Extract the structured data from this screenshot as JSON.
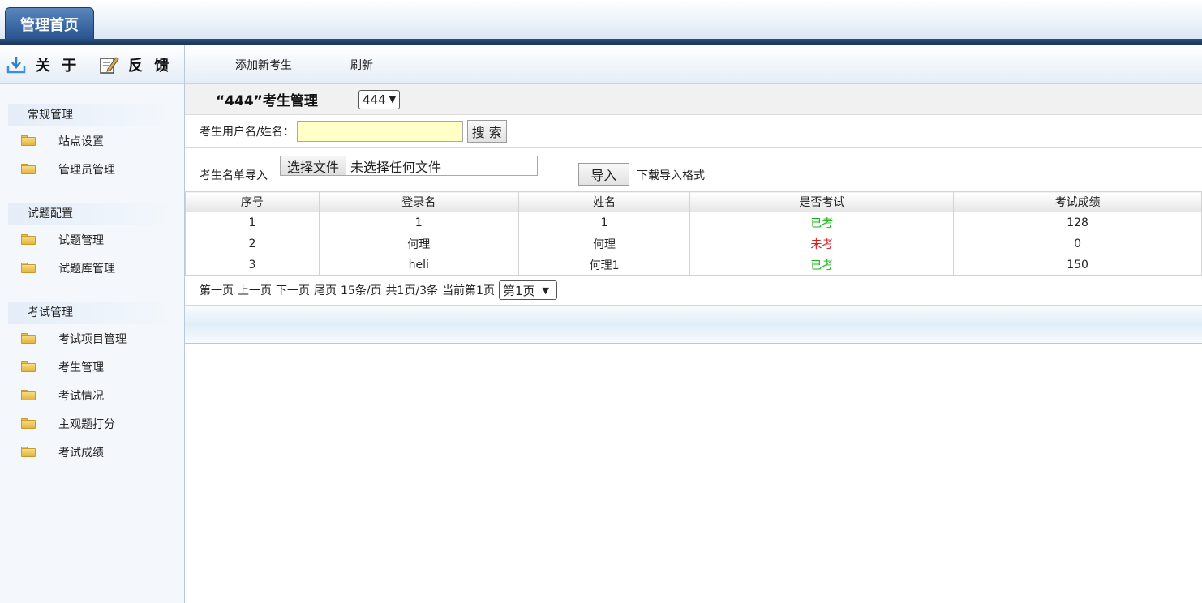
{
  "header": {
    "home_tab": "管理首页"
  },
  "sidebar": {
    "tools": {
      "about": "关 于",
      "feedback": "反 馈"
    },
    "sections": [
      {
        "title": "常规管理",
        "items": [
          "站点设置",
          "管理员管理"
        ]
      },
      {
        "title": "试题配置",
        "items": [
          "试题管理",
          "试题库管理"
        ]
      },
      {
        "title": "考试管理",
        "items": [
          "考试项目管理",
          "考生管理",
          "考试情况",
          "主观题打分",
          "考试成绩"
        ]
      }
    ]
  },
  "toolbar": {
    "add": "添加新考生",
    "refresh": "刷新"
  },
  "page": {
    "title": "“444”考生管理",
    "exam_select": "444"
  },
  "search": {
    "label": "考生用户名/姓名：",
    "value": "",
    "button": "搜 索"
  },
  "import": {
    "label": "考生名单导入",
    "file_button": "选择文件",
    "file_status": "未选择任何文件",
    "import_button": "导入",
    "download_link": "下载导入格式"
  },
  "table": {
    "columns": [
      "序号",
      "登录名",
      "姓名",
      "是否考试",
      "考试成绩"
    ],
    "rows": [
      {
        "no": "1",
        "login": "1",
        "name": "1",
        "status": "已考",
        "score": "128"
      },
      {
        "no": "2",
        "login": "何理",
        "name": "何理",
        "status": "未考",
        "score": "0"
      },
      {
        "no": "3",
        "login": "heli",
        "name": "何理1",
        "status": "已考",
        "score": "150"
      }
    ]
  },
  "pager": {
    "first": "第一页",
    "prev": "上一页",
    "next": "下一页",
    "last": "尾页",
    "per_page": "15条/页",
    "total": "共1页/3条",
    "current": "当前第1页",
    "page_select": "第1页"
  },
  "colors": {
    "taken": "#13b413",
    "not_taken": "#d81a1a",
    "nav_dark": "#173256"
  }
}
